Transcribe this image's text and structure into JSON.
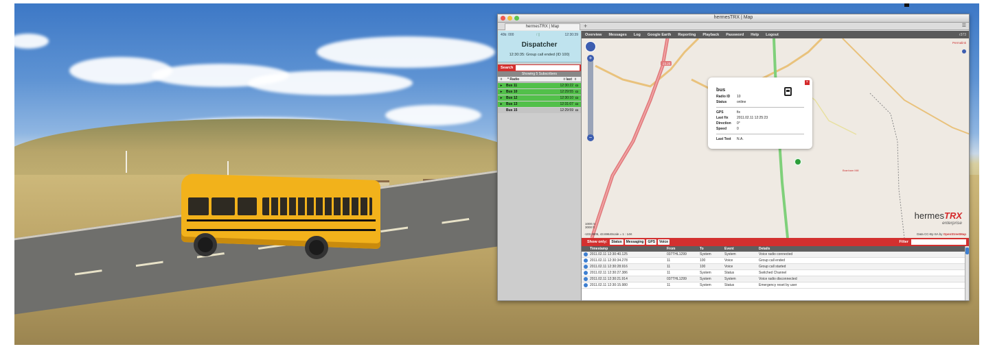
{
  "window": {
    "title": "hermesTRX | Map",
    "tab_label": "hermesTRX | Map",
    "new_tab": "+",
    "tab_menu": "☰"
  },
  "status": {
    "id": "40b: 000",
    "signal": "/ ||",
    "time": "12:30:39",
    "title": "Dispatcher",
    "message": "12:30:35: Group call ended (ID 100)"
  },
  "search": {
    "label": "Search",
    "placeholder": ""
  },
  "subscribers": {
    "showing": "Showing 5 Subscribers",
    "headers": {
      "sort": "◊",
      "radio": "* Radio",
      "last": "◊ last",
      "extra": "◊"
    },
    "rows": [
      {
        "name": "Bus 11",
        "time": "12:30:22",
        "state": "online"
      },
      {
        "name": "Bus 10",
        "time": "12:29:55",
        "state": "online"
      },
      {
        "name": "Bus 12",
        "time": "12:30:10",
        "state": "online"
      },
      {
        "name": "Bus 13",
        "time": "12:31:07",
        "state": "online"
      },
      {
        "name": "Bus 15",
        "time": "12:29:59",
        "state": "offline"
      }
    ]
  },
  "nav": {
    "items": [
      "Overview",
      "Messages",
      "Log",
      "Google Earth",
      "Reporting",
      "Playback",
      "Password",
      "Help",
      "Logout"
    ],
    "right": "r373"
  },
  "map": {
    "top_right": "Permalink",
    "road_label": "23.25",
    "town": "Branham Mill",
    "scale_top": "1000 m",
    "scale_bottom": "3000 ft",
    "coords": "-103.3605, 43.6964Scale = 1 : 14K",
    "logo_prefix": "hermes",
    "logo_brand": "TRX",
    "logo_sub": "enterprise",
    "attribution_prefix": "Data CC-By-SA by",
    "attribution_link": "OpenStreetMap"
  },
  "popup": {
    "title": "bus",
    "close": "×",
    "fields": [
      {
        "k": "Radio ID",
        "v": "10"
      },
      {
        "k": "Status",
        "v": "online"
      },
      {
        "k": "GPS",
        "v": "fix"
      },
      {
        "k": "Last fix",
        "v": "2011.02.11 12:25:23"
      },
      {
        "k": "Direction",
        "v": "0°"
      },
      {
        "k": "Speed",
        "v": "0"
      },
      {
        "k": "Last Text",
        "v": "N.A."
      }
    ]
  },
  "events": {
    "show_only": "Show only:",
    "filters": [
      "Status",
      "Messaging",
      "GPS",
      "Voice"
    ],
    "filter_label": "Filter",
    "headers": [
      "Timestamp",
      "From",
      "To",
      "Event",
      "Details"
    ],
    "rows": [
      {
        "ts": "2011.02.11 12:30:40.125",
        "from": "037THL1299",
        "to": "System",
        "event": "System",
        "details": "Voice radio connected"
      },
      {
        "ts": "2011.02.11 12:30:34.278",
        "from": "11",
        "to": "100",
        "event": "Voice",
        "details": "Group call ended"
      },
      {
        "ts": "2011.02.11 12:30:28.916",
        "from": "11",
        "to": "100",
        "event": "Voice",
        "details": "Group call started"
      },
      {
        "ts": "2011.02.11 12:30:27.386",
        "from": "11",
        "to": "System",
        "event": "Status",
        "details": "Switched Channel"
      },
      {
        "ts": "2011.02.11 12:30:21.914",
        "from": "037THL1299",
        "to": "System",
        "event": "System",
        "details": "Voice radio disconnected"
      },
      {
        "ts": "2011.02.11 12:30:15.980",
        "from": "11",
        "to": "System",
        "event": "Status",
        "details": "Emergency reset by user"
      }
    ]
  },
  "colors": {
    "accent_red": "#d3302f",
    "online_green": "#52c04a",
    "status_blue": "#bfe3ee"
  }
}
